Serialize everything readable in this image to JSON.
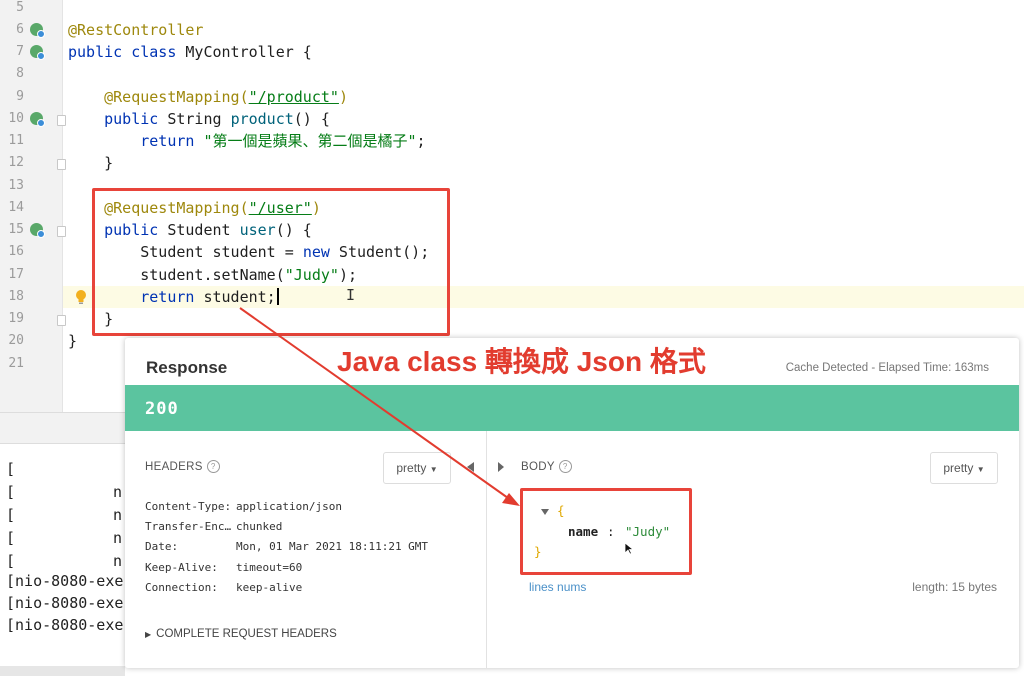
{
  "editor": {
    "line_numbers": [
      "5",
      "6",
      "7",
      "8",
      "9",
      "10",
      "11",
      "12",
      "13",
      "14",
      "15",
      "16",
      "17",
      "18",
      "19",
      "20",
      "21"
    ],
    "lines": {
      "l6_annotation": "@RestController",
      "l7_public": "public",
      "l7_class": "class",
      "l7_rest": "MyController {",
      "l9_annotation": "@RequestMapping(",
      "l9_path": "\"/product\"",
      "l9_close": ")",
      "l10_public": "public",
      "l10_type": "String",
      "l10_method": "product",
      "l10_rest": "() {",
      "l11_return": "return",
      "l11_string": "\"第一個是蘋果、第二個是橘子\"",
      "l11_semi": ";",
      "l12": "}",
      "l14_annotation": "@RequestMapping(",
      "l14_path": "\"/user\"",
      "l14_close": ")",
      "l15_public": "public",
      "l15_type": "Student",
      "l15_method": "user",
      "l15_rest": "() {",
      "l16_a": "Student student = ",
      "l16_new": "new",
      "l16_b": " Student();",
      "l17_a": "student.setName(",
      "l17_string": "\"Judy\"",
      "l17_b": ");",
      "l18_return": "return",
      "l18_rest": " student;",
      "l19": "}",
      "l20": "}"
    }
  },
  "console": {
    "lines": [
      "[",
      "[",
      "[",
      "[",
      "[",
      "[nio-8080-exe",
      "[nio-8080-exe",
      "[nio-8080-exe"
    ],
    "fragment": "n"
  },
  "caption": "Java class 轉換成 Json 格式",
  "response": {
    "title": "Response",
    "meta": "Cache Detected - Elapsed Time: 163ms",
    "status_code": "200",
    "status_color": "#5bc49f",
    "headers_label": "HEADERS",
    "body_label": "BODY",
    "pretty_label": "pretty",
    "headers": [
      {
        "key": "Content-Type:",
        "value": "application/json"
      },
      {
        "key": "Transfer-Enc…",
        "value": "chunked"
      },
      {
        "key": "Date:",
        "value": "Mon, 01 Mar 2021 18:11:21 GMT"
      },
      {
        "key": "Keep-Alive:",
        "value": "timeout=60"
      },
      {
        "key": "Connection:",
        "value": "keep-alive"
      }
    ],
    "complete_headers_label": "COMPLETE REQUEST HEADERS",
    "body_json": {
      "open_brace": "{",
      "key": "name",
      "colon": ":",
      "value": "\"Judy\"",
      "close_brace": "}"
    },
    "lines_nums_label": "lines nums",
    "length_label": "length: 15 bytes"
  },
  "colors": {
    "highlight_red": "#e8443a",
    "caption_red": "#e23c2f"
  }
}
